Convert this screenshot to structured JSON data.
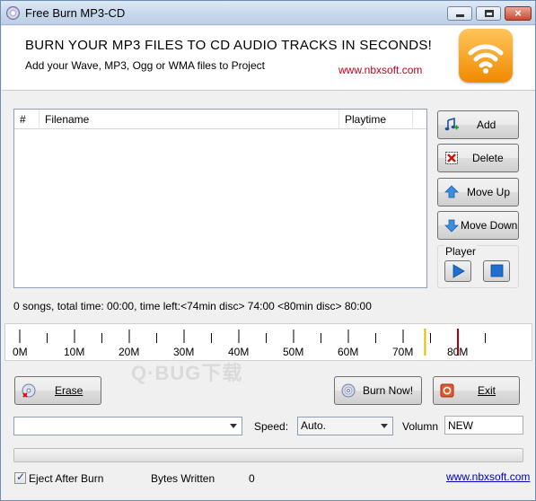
{
  "window": {
    "title": "Free Burn MP3-CD",
    "controls": {
      "minimize": "minimize",
      "maximize": "maximize",
      "close": "×"
    }
  },
  "banner": {
    "headline": "BURN YOUR MP3 FILES TO CD AUDIO TRACKS IN SECONDS!",
    "subline": "Add your Wave, MP3, Ogg or WMA files to Project",
    "url": "www.nbxsoft.com",
    "logo_icon": "wifi-broadcast-icon"
  },
  "filelist": {
    "columns": [
      "#",
      "Filename",
      "Playtime"
    ],
    "rows": []
  },
  "side_buttons": {
    "add": "Add",
    "delete": "Delete",
    "move_up": "Move Up",
    "move_down": "Move Down"
  },
  "player": {
    "label": "Player",
    "play_icon": "play-icon",
    "stop_icon": "stop-icon"
  },
  "status_text": "0 songs, total time: 00:00, time left:<74min disc> 74:00 <80min disc> 80:00",
  "ruler": {
    "labels": [
      "0M",
      "10M",
      "20M",
      "30M",
      "40M",
      "50M",
      "60M",
      "70M",
      "80M"
    ],
    "max_mb": 85,
    "markers": [
      {
        "name": "74min-marker",
        "mb": 74,
        "color": "#e8b800"
      },
      {
        "name": "80min-marker",
        "mb": 80,
        "color": "#b00000"
      }
    ]
  },
  "watermark": "Q·BUG下载",
  "bottom_buttons": {
    "erase": "Erase",
    "burn_now": "Burn Now!",
    "exit": "Exit"
  },
  "device": {
    "selected": ""
  },
  "speed": {
    "label": "Speed:",
    "selected": "Auto."
  },
  "volumn": {
    "label": "Volumn",
    "value": "NEW"
  },
  "progress": {
    "value": 0
  },
  "footer": {
    "eject_label": "Eject After Burn",
    "eject_checked": true,
    "bytes_label": "Bytes Written",
    "bytes_value": "0",
    "link": "www.nbxsoft.com"
  },
  "colors": {
    "accent_url": "#c8001e",
    "link": "#0000c0",
    "logo_orange": "#f08a00"
  }
}
